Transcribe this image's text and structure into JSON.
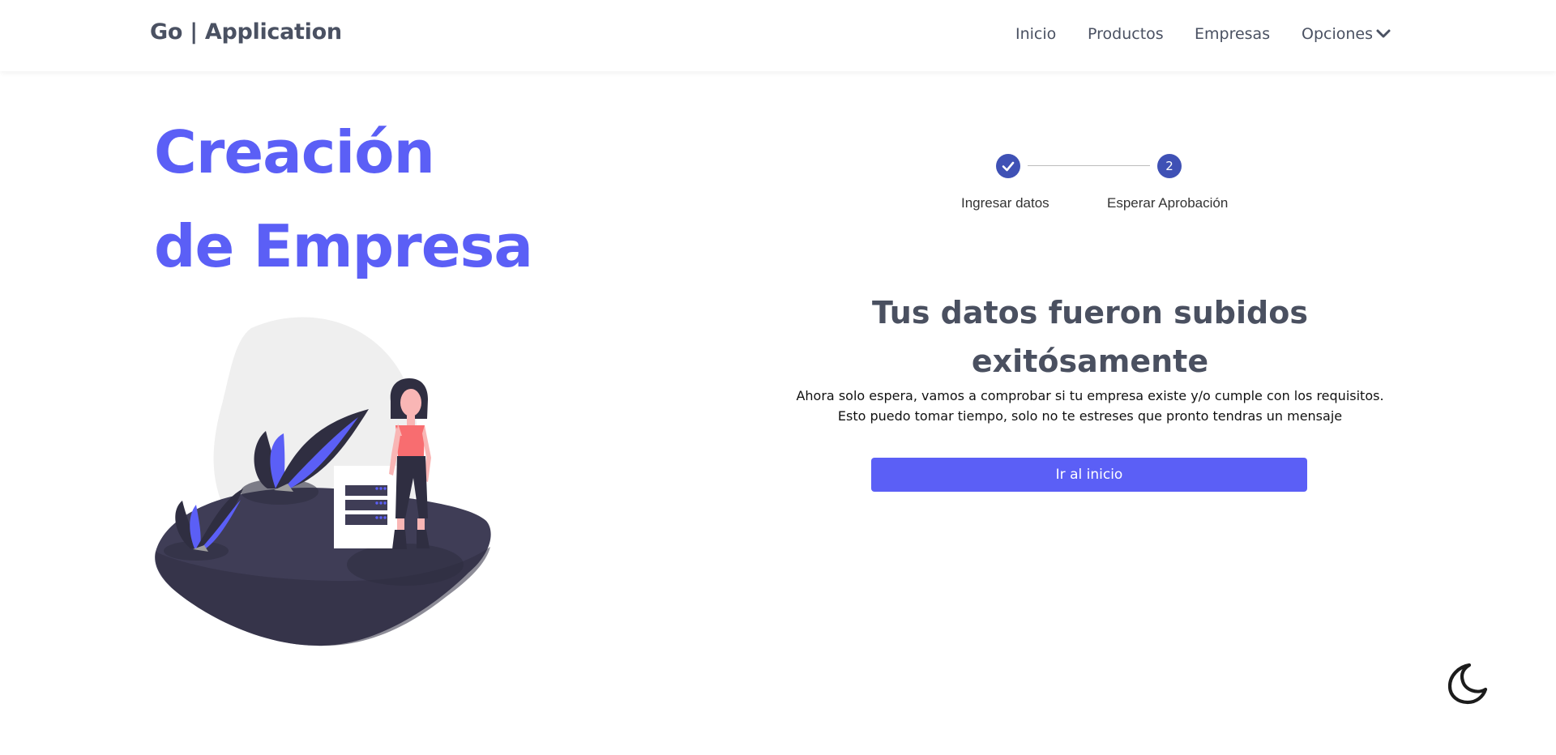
{
  "navbar": {
    "brand": "Go | Application",
    "links": [
      "Inicio",
      "Productos",
      "Empresas",
      "Opciones"
    ],
    "dropdown_icon": "chevron-down-icon"
  },
  "hero": {
    "title_line1": "Creación",
    "title_line2": "de Empresa"
  },
  "stepper": {
    "steps": [
      {
        "label": "Ingresar datos",
        "status": "completed",
        "icon": "check-icon"
      },
      {
        "label": "Esperar Aprobación",
        "status": "active",
        "number": "2"
      }
    ]
  },
  "success": {
    "title": "Tus datos fueron subidos exitósamente",
    "line1": "Ahora solo espera, vamos a comprobar si tu empresa existe y/o cumple con los requisitos.",
    "line2": "Esto puedo tomar tiempo, solo no te estreses que pronto tendras un mensaje",
    "button_label": "Ir al inicio"
  },
  "theme_toggle": {
    "icon": "moon-icon"
  },
  "colors": {
    "accent": "#5b5ff6",
    "stepper": "#3f51b5",
    "text": "#4a5060"
  }
}
